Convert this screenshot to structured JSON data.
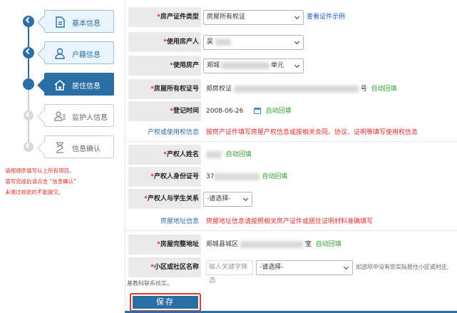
{
  "steps": [
    {
      "label": "基本信息",
      "icon": "document-icon",
      "state": "done"
    },
    {
      "label": "户籍信息",
      "icon": "person-icon",
      "state": "done"
    },
    {
      "label": "居住信息",
      "icon": "home-icon",
      "state": "active"
    },
    {
      "label": "监护人信息",
      "icon": "guardian-icon",
      "state": "todo"
    },
    {
      "label": "信息确认",
      "icon": "hourglass-icon",
      "state": "todo"
    }
  ],
  "sidebar_note": [
    "请按顺序填写以上所有项目。",
    "填写完成后请点击 “信息确认”",
    "未通过校验的不能提交。"
  ],
  "form": {
    "cert_type": {
      "label": "房产证件类型",
      "value": "房屋所有权证",
      "link": "查看证件示例"
    },
    "user": {
      "label": "使用房产人",
      "value": "吴"
    },
    "property": {
      "label": "使用房产",
      "value": "郑城",
      "suffix": "单元"
    },
    "cert_no": {
      "label": "房屋所有权证号",
      "value": "郑房权证",
      "suffix": "号",
      "auto": "自动回填"
    },
    "reg_date": {
      "label": "登记时间",
      "value": "2008-06-26",
      "auto": "自动回填"
    },
    "owner_section": {
      "title": "产权或使用权信息",
      "desc": "按房产证件填写房屋产权信息或按相关合同、协议、证明等填写使用权信息"
    },
    "owner_name": {
      "label": "产权人姓名",
      "auto": "自动回填"
    },
    "owner_id": {
      "label": "产权人身份证号",
      "value": "37",
      "auto": "自动回填"
    },
    "relation": {
      "label": "产权人与学生关系",
      "value": "-请选择-"
    },
    "addr_section": {
      "title": "房屋地址信息",
      "desc": "房屋地址信息请按照相关房产证件或居住证明材料准确填写"
    },
    "address": {
      "label": "房屋完整地址",
      "value": "郑城县城区",
      "suffix": "室",
      "auto": "自动回填"
    },
    "community": {
      "label": "小区或社区名称",
      "placeholder": "输入关键字筛选",
      "value": "-请选择-",
      "hint": "如选项中没有您实际居住小区或村庄,"
    },
    "wrap_hint": "基教科联系核实。"
  },
  "save_label": "保存",
  "colors": {
    "primary": "#2a6ea4",
    "required": "#e02b2b",
    "auto_fill": "#2e9e2e",
    "link": "#1a4fd6"
  }
}
